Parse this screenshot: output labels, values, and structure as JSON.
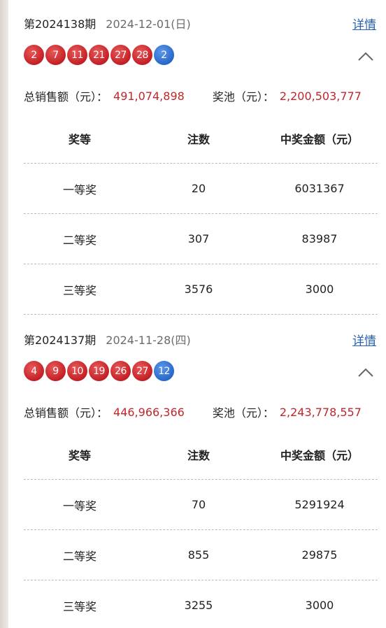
{
  "draws": [
    {
      "issue": "第2024138期",
      "date": "2024-12-01(日)",
      "detail_label": "详情",
      "red_balls": [
        "2",
        "7",
        "11",
        "21",
        "27",
        "28"
      ],
      "blue_balls": [
        "2"
      ],
      "sales_label": "总销售额（元）：",
      "sales_value": "491,074,898",
      "pool_label": "奖池（元）：",
      "pool_value": "2,200,503,777",
      "headers": [
        "奖等",
        "注数",
        "中奖金额（元）"
      ],
      "prizes": [
        {
          "level": "一等奖",
          "count": "20",
          "amount": "6031367"
        },
        {
          "level": "二等奖",
          "count": "307",
          "amount": "83987"
        },
        {
          "level": "三等奖",
          "count": "3576",
          "amount": "3000"
        }
      ]
    },
    {
      "issue": "第2024137期",
      "date": "2024-11-28(四)",
      "detail_label": "详情",
      "red_balls": [
        "4",
        "9",
        "10",
        "19",
        "26",
        "27"
      ],
      "blue_balls": [
        "12"
      ],
      "sales_label": "总销售额（元）：",
      "sales_value": "446,966,366",
      "pool_label": "奖池（元）：",
      "pool_value": "2,243,778,557",
      "headers": [
        "奖等",
        "注数",
        "中奖金额（元）"
      ],
      "prizes": [
        {
          "level": "一等奖",
          "count": "70",
          "amount": "5291924"
        },
        {
          "level": "二等奖",
          "count": "855",
          "amount": "29875"
        },
        {
          "level": "三等奖",
          "count": "3255",
          "amount": "3000"
        }
      ]
    }
  ],
  "colors": {
    "red_ball": "#c31f24",
    "blue_ball": "#2668c9",
    "money": "#c0262c",
    "link": "#2a5fb7"
  },
  "icons": {
    "collapse": "chevron-up-icon"
  }
}
